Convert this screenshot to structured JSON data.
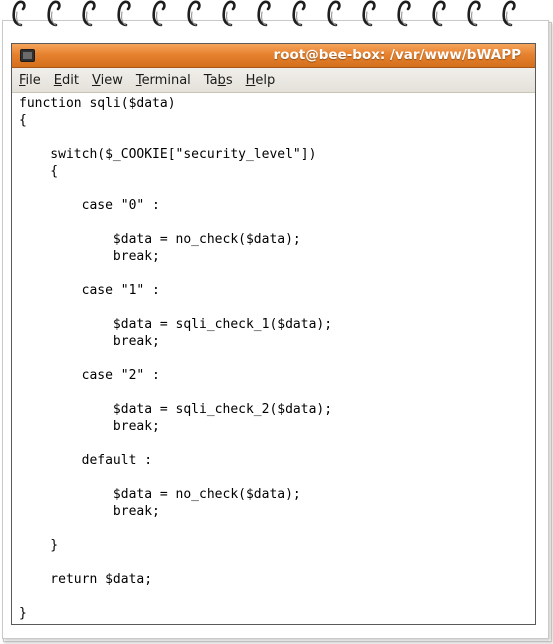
{
  "window": {
    "title": "root@bee-box: /var/www/bWAPP"
  },
  "menubar": {
    "items": [
      {
        "pre": "",
        "mnemonic": "F",
        "post": "ile"
      },
      {
        "pre": "",
        "mnemonic": "E",
        "post": "dit"
      },
      {
        "pre": "",
        "mnemonic": "V",
        "post": "iew"
      },
      {
        "pre": "",
        "mnemonic": "T",
        "post": "erminal"
      },
      {
        "pre": "Ta",
        "mnemonic": "b",
        "post": "s"
      },
      {
        "pre": "",
        "mnemonic": "H",
        "post": "elp"
      }
    ]
  },
  "terminal": {
    "lines": [
      "function sqli($data)",
      "{",
      "",
      "    switch($_COOKIE[\"security_level\"])",
      "    {",
      "",
      "        case \"0\" :",
      "",
      "            $data = no_check($data);",
      "            break;",
      "",
      "        case \"1\" :",
      "",
      "            $data = sqli_check_1($data);",
      "            break;",
      "",
      "        case \"2\" :",
      "",
      "            $data = sqli_check_2($data);",
      "            break;",
      "",
      "        default :",
      "",
      "            $data = no_check($data);",
      "            break;",
      "",
      "    }",
      "",
      "    return $data;",
      "",
      "}"
    ]
  },
  "colors": {
    "titlebar_accent": "#e6822f",
    "menubar_bg": "#ebe8e2",
    "terminal_bg": "#ffffff",
    "terminal_fg": "#000000"
  },
  "icons": {
    "window_icon": "terminal-icon",
    "binding": "spiral-ring-icon"
  }
}
